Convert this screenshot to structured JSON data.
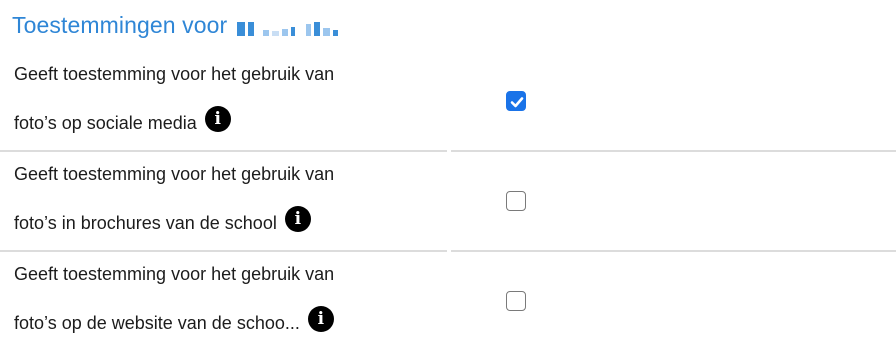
{
  "header": {
    "title": "Toestemmingen voor"
  },
  "permissions": [
    {
      "line1": "Geeft toestemming voor het gebruik van",
      "line2": "foto’s op sociale media",
      "checked": true,
      "info_icon": "info-circle-icon"
    },
    {
      "line1": "Geeft toestemming voor het gebruik van",
      "line2": "foto’s in brochures van de school",
      "checked": false,
      "info_icon": "info-circle-icon"
    },
    {
      "line1": "Geeft toestemming voor het gebruik van",
      "line2": "foto’s op de website van de schoo...",
      "checked": false,
      "info_icon": "info-circle-icon"
    }
  ],
  "colors": {
    "title": "#2f86d6",
    "checkbox_checked": "#1a73e8",
    "separator": "#dcdcdc"
  }
}
